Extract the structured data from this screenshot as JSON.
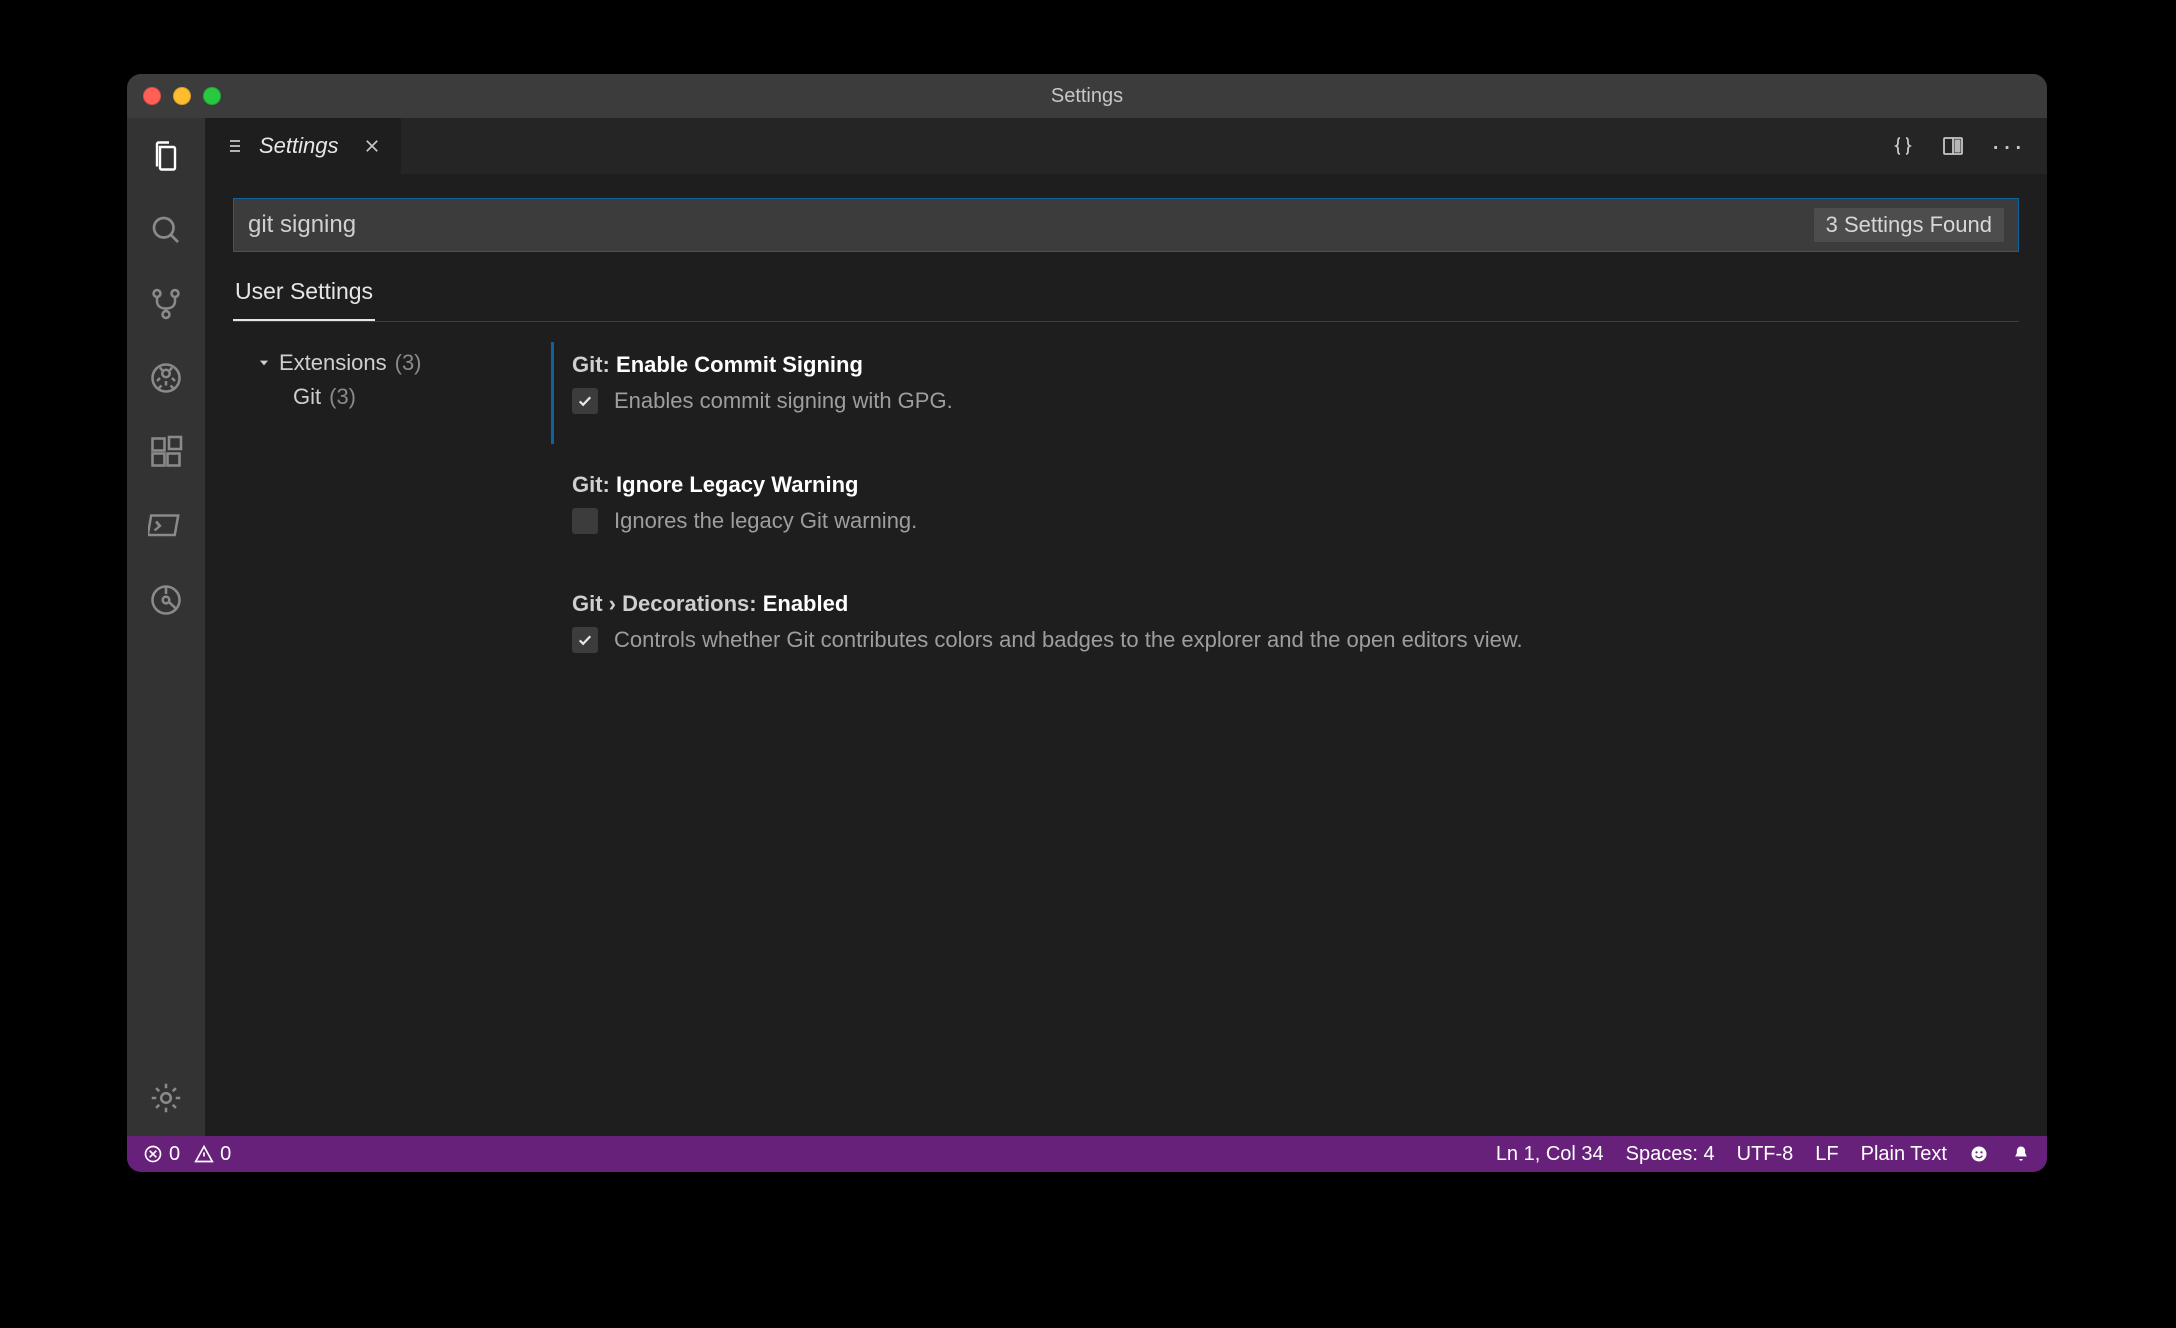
{
  "window": {
    "title": "Settings"
  },
  "tab": {
    "label": "Settings"
  },
  "search": {
    "value": "git signing",
    "results_badge": "3 Settings Found"
  },
  "scope": {
    "user_tab": "User Settings"
  },
  "toc": {
    "extensions_label": "Extensions",
    "extensions_count": "(3)",
    "git_label": "Git",
    "git_count": "(3)"
  },
  "settings": [
    {
      "scope": "Git:",
      "name": "Enable Commit Signing",
      "checked": true,
      "modified": true,
      "description": "Enables commit signing with GPG."
    },
    {
      "scope": "Git:",
      "name": "Ignore Legacy Warning",
      "checked": false,
      "modified": false,
      "description": "Ignores the legacy Git warning."
    },
    {
      "scope": "Git › Decorations:",
      "name": "Enabled",
      "checked": true,
      "modified": false,
      "description": "Controls whether Git contributes colors and badges to the explorer and the open editors view."
    }
  ],
  "statusbar": {
    "errors": "0",
    "warnings": "0",
    "cursor": "Ln 1, Col 34",
    "spaces": "Spaces: 4",
    "encoding": "UTF-8",
    "eol": "LF",
    "language": "Plain Text"
  }
}
